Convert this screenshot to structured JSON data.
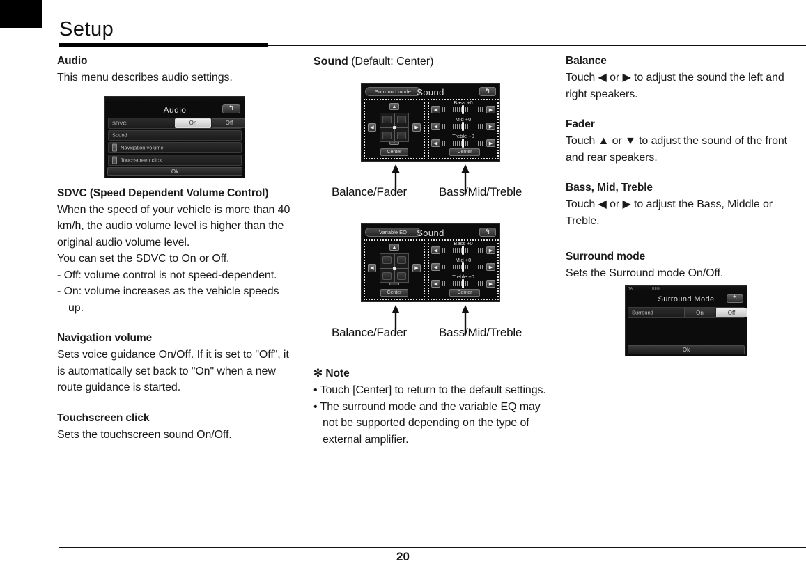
{
  "page": {
    "title": "Setup",
    "number": "20"
  },
  "left_column": {
    "audio_heading": "Audio",
    "audio_intro": "This menu describes audio settings.",
    "sdvc_heading": "SDVC (Speed Dependent Volume Control)",
    "sdvc_body": "When the speed of your vehicle is more than 40 km/h, the audio volume level is higher than the original audio volume level.",
    "sdvc_body2": "You can set the SDVC to On or Off.",
    "sdvc_items": [
      "- Off: volume control is not speed-dependent.",
      "- On: volume increases as the vehicle speeds up."
    ],
    "nav_volume_heading": "Navigation volume",
    "nav_volume_body": "Sets voice guidance On/Off. If it is set to \"Off\", it is automatically set back to \"On\" when a new route guidance is started.",
    "touchscreen_heading": "Touchscreen click",
    "touchscreen_body": "Sets the touchscreen sound On/Off."
  },
  "mid_column": {
    "sound_heading_bold": "Sound",
    "sound_heading_rest": " (Default: Center)",
    "callout1_left": "Balance/Fader",
    "callout1_right": "Bass/Mid/Treble",
    "callout2_left": "Balance/Fader",
    "callout2_right": "Bass/Mid/Treble",
    "note_star": "✻",
    "note_label": "Note",
    "note_items": [
      "• Touch [Center] to return to the default settings.",
      "• The surround mode and the variable EQ may not be supported depending on the type of external amplifier."
    ]
  },
  "right_column": {
    "balance_heading": "Balance",
    "balance_body": "Touch ◀ or ▶ to adjust the sound the left and right speakers.",
    "fader_heading": "Fader",
    "fader_body": "Touch ▲ or ▼ to adjust the sound of the front and rear speakers.",
    "bmt_heading": "Bass, Mid, Treble",
    "bmt_body": "Touch ◀ or ▶ to adjust the Bass, Middle or Treble.",
    "surround_heading": "Surround mode",
    "surround_body": "Sets the Surround mode On/Off."
  },
  "audio_screen": {
    "title": "Audio",
    "back_icon": "↰",
    "rows": [
      {
        "label": "SDVC",
        "on": "On",
        "off": "Off",
        "selected": "On"
      },
      {
        "label": "Sound"
      },
      {
        "label": "Navigation volume"
      },
      {
        "label": "Touchscreen click"
      }
    ],
    "ok_label": "Ok"
  },
  "sound_screen_1": {
    "mode_button": "Surround mode",
    "title": "Sound",
    "back_icon": "↰",
    "left_center_label": "Center",
    "right_center_label": "Center",
    "sliders": [
      {
        "label": "Bass +0"
      },
      {
        "label": "Mid +0"
      },
      {
        "label": "Treble +0"
      }
    ],
    "arrows": {
      "up": "▲",
      "down": "▼",
      "left": "◀",
      "right": "▶"
    }
  },
  "sound_screen_2": {
    "mode_button": "Variable EQ",
    "title": "Sound",
    "back_icon": "↰",
    "left_center_label": "Center",
    "right_center_label": "Center",
    "sliders": [
      {
        "label": "Bass +0"
      },
      {
        "label": "Mid +0"
      },
      {
        "label": "Treble +0"
      }
    ],
    "arrows": {
      "up": "▲",
      "down": "▼",
      "left": "◀",
      "right": "▶"
    }
  },
  "surround_screen": {
    "status_ta": "TA",
    "status_reg": "REG",
    "title": "Surround Mode",
    "back_icon": "↰",
    "row_label": "Surround",
    "on": "On",
    "off": "Off",
    "selected": "Off",
    "ok_label": "Ok"
  },
  "colors": {
    "ink": "#111111",
    "rule": "#000000",
    "device_bg": "#0c0c0c",
    "highlight": "#e0e0e0"
  }
}
